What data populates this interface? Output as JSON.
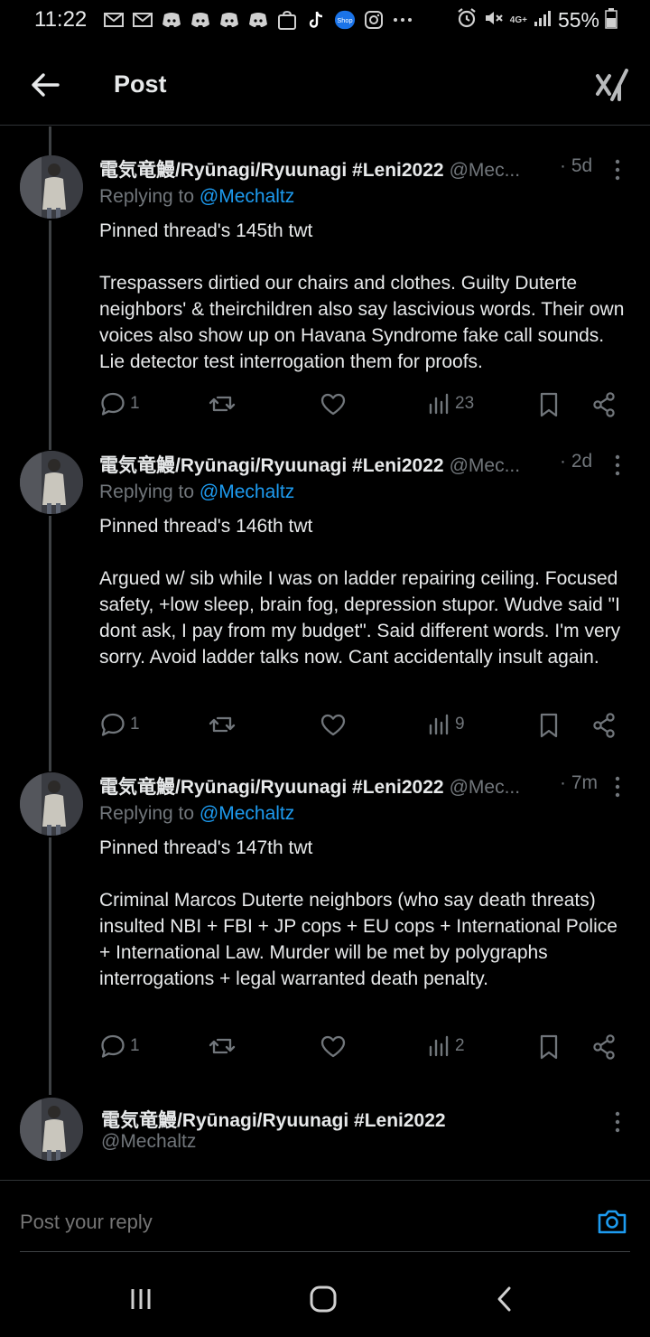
{
  "status": {
    "time": "11:22",
    "battery": "55%",
    "network": "4G+",
    "notification_icons": [
      "gmail-icon",
      "gmail-icon",
      "discord-icon",
      "discord-icon",
      "discord-icon",
      "discord-icon",
      "shopee-icon",
      "tiktok-icon",
      "shop-icon",
      "instagram-icon",
      "more-icon"
    ]
  },
  "header": {
    "title": "Post"
  },
  "posts": [
    {
      "name": "電気竜鰻/Ryūnagi/Ryuunagi #Leni2022",
      "handle": "@Mec...",
      "time": "· 5d",
      "replying_prefix": "Replying to ",
      "replying_to": "@Mechaltz",
      "text": "Pinned thread's 145th twt\n\nTrespassers dirtied our chairs and clothes. Guilty Duterte neighbors' & theirchildren also say lascivious words. Their own voices also show up on Havana Syndrome fake call sounds. Lie detector test interrogation them for proofs.",
      "replies": "1",
      "views": "23"
    },
    {
      "name": "電気竜鰻/Ryūnagi/Ryuunagi #Leni2022",
      "handle": "@Mec...",
      "time": "· 2d",
      "replying_prefix": "Replying to ",
      "replying_to": "@Mechaltz",
      "text": "Pinned thread's 146th twt\n\nArgued w/ sib while I was on ladder repairing ceiling. Focused safety, +low sleep, brain fog, depression stupor. Wudve said \"I dont ask, I pay from my budget\". Said different words. I'm very sorry. Avoid ladder talks now. Cant accidentally insult again.",
      "replies": "1",
      "views": "9"
    },
    {
      "name": "電気竜鰻/Ryūnagi/Ryuunagi #Leni2022",
      "handle": "@Mec...",
      "time": "· 7m",
      "replying_prefix": "Replying to ",
      "replying_to": "@Mechaltz",
      "text": "Pinned thread's 147th twt\n\nCriminal Marcos Duterte neighbors (who say death threats) insulted NBI + FBI + JP cops + EU cops + International Police + International Law. Murder will be met by polygraphs interrogations + legal warranted death penalty.",
      "replies": "1",
      "views": "2"
    }
  ],
  "author_card": {
    "name": "電気竜鰻/Ryūnagi/Ryuunagi #Leni2022",
    "handle": "@Mechaltz"
  },
  "reply_bar": {
    "placeholder": "Post your reply"
  },
  "colors": {
    "accent": "#1d9bf0",
    "muted": "#71767b",
    "text": "#e7e9ea",
    "background": "#000000"
  }
}
